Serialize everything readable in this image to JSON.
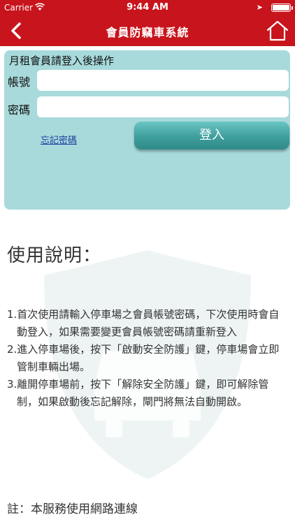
{
  "status_bar": {
    "carrier": "Carrier",
    "time": "9:44 AM"
  },
  "nav": {
    "title": "會員防竊車系統",
    "back_icon": "chevron-left-icon",
    "home_icon": "home-icon"
  },
  "login": {
    "hint": "月租會員請登入後操作",
    "account_label": "帳號",
    "account_value": "",
    "password_label": "密碼",
    "password_value": "",
    "forgot_link": "忘記密碼",
    "login_button": "登入"
  },
  "instructions": {
    "title": "使用說明：",
    "items": [
      "1.首次使用請輸入停車場之會員帳號密碼，下次使用時會自動登入，如果需要變更會員帳號密碼請重新登入",
      "2.進入停車場後，按下「啟動安全防護」鍵，停車場會立即管制車輛出場。",
      "3.離開停車場前，按下「解除安全防護」鍵，即可解除管制，如果啟動後忘記解除，閘門將無法自動開啟。"
    ],
    "note": "註：本服務使用網路連線"
  },
  "colors": {
    "header": "#c8141c",
    "panel": "#a8dadb",
    "button": "#3e9e9c",
    "link": "#1f3ea0"
  }
}
